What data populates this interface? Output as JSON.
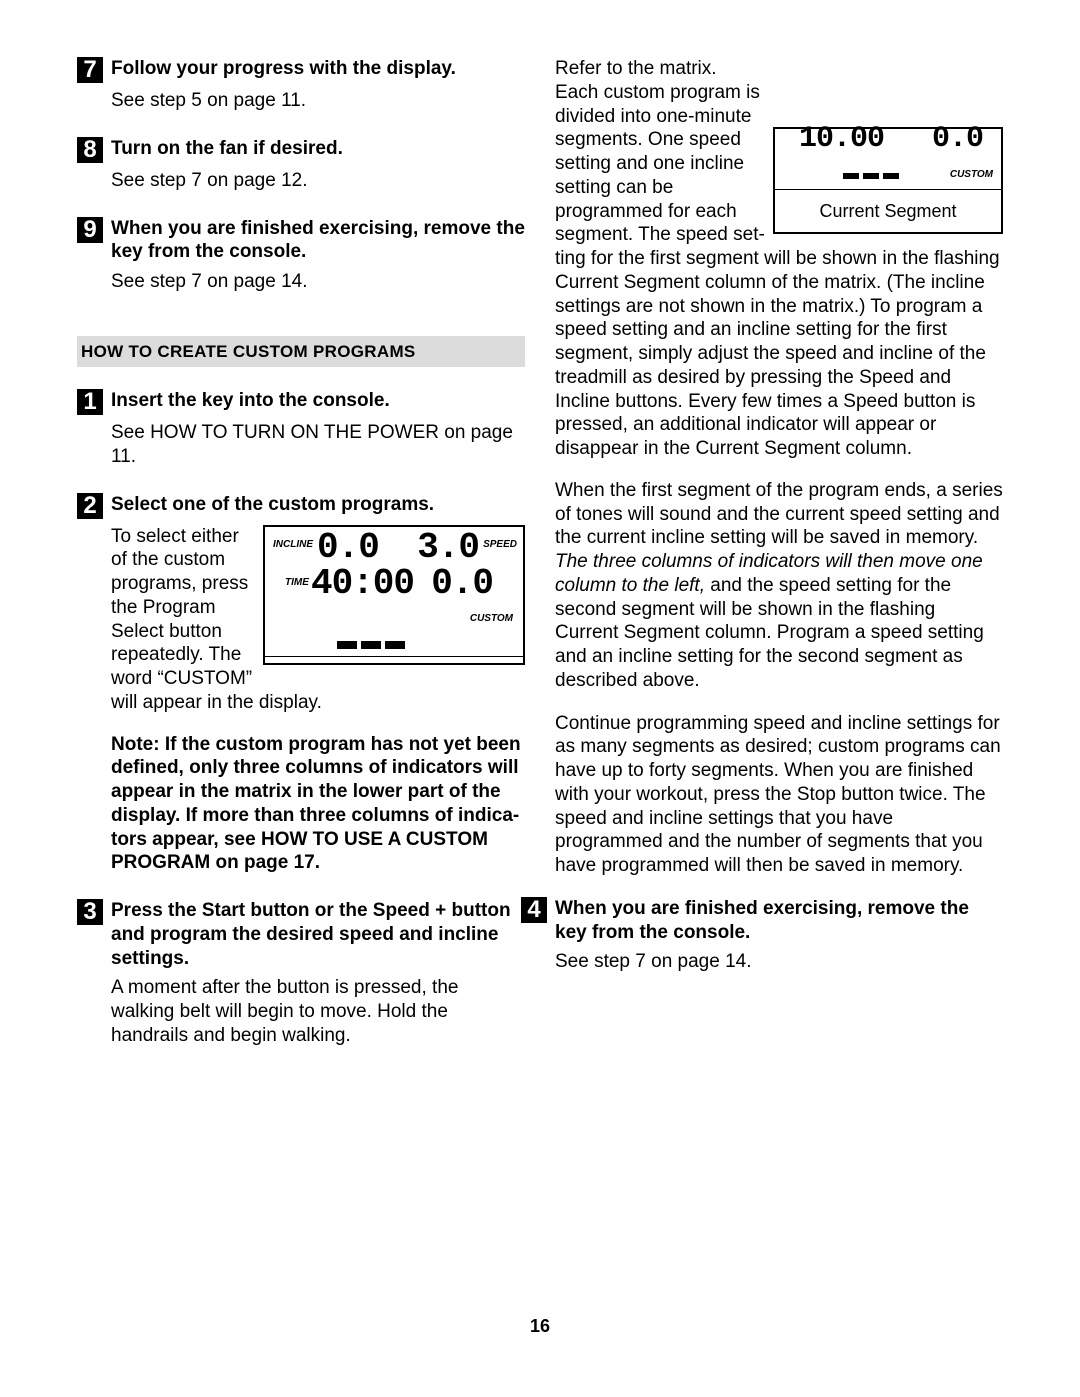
{
  "left": {
    "step7": {
      "num": "7",
      "title": "Follow your progress with the display.",
      "body": "See step 5 on page 11."
    },
    "step8": {
      "num": "8",
      "title": "Turn on the fan if desired.",
      "body": "See step 7 on page 12."
    },
    "step9": {
      "num": "9",
      "title": "When you are finished exercising, remove the key from the console.",
      "body": "See step 7 on page 14."
    },
    "sectionTitle": "HOW TO CREATE CUSTOM PROGRAMS",
    "c1": {
      "num": "1",
      "title": "Insert the key into the console.",
      "body": "See HOW TO TURN ON THE POWER on page 11."
    },
    "c2": {
      "num": "2",
      "title": "Select one of the custom programs.",
      "wrapText": "To select ei­ther of the custom pro­grams, press the Program Select but­ton repeat­edly. The word “CUSTOM” will appear in the display.",
      "note": "Note: If the custom program has not yet been defined, only three columns of indicators will appear in the matrix in the lower part of the display. If more than three columns of indica­tors appear, see HOW TO USE A CUSTOM PROGRAM on page 17.",
      "lcd": {
        "inclineLabel": "INCLINE",
        "incline": "0.0",
        "speedLabel": "SPEED",
        "speed": "3.0",
        "timeLabel": "TIME",
        "time": "40:00",
        "extra": "0.0",
        "custom": "CUSTOM"
      }
    },
    "c3": {
      "num": "3",
      "title": "Press the Start button or the Speed + button and program the desired speed and incline settings.",
      "body": "A moment after the button is pressed, the walking belt will begin to move. Hold the handrails and begin walking."
    }
  },
  "right": {
    "p1a": "Refer to the matrix. Each custom program is di­vided into one-minute segments. One speed set­ting and one incline setting can be programmed for each seg­ment. The speed set­ting for the first segment will be shown in the flashing Current Segment column of the matrix. (The in­cline settings are not shown in the matrix.) To pro­gram a speed setting and an incline setting for the first segment, simply adjust the speed and incline of the treadmill as desired by pressing the Speed and Incline buttons. Every few times a Speed but­ton is pressed, an additional indicator will appear or disappear in the Current Segment column.",
    "lcdSmall": {
      "big": "10.00",
      "small": "0.0",
      "custom": "CUSTOM",
      "caption": "Current Segment"
    },
    "p2a": "When the first segment of the program ends, a se­ries of tones will sound and the current speed set­ting and the current incline setting will be saved in memory. ",
    "p2i": "The three columns of indicators will then move one column to the left,",
    "p2b": " and the speed set­ting for the second segment will be shown in the flashing Current Segment column. Program a speed setting and an incline setting for the second segment as described above.",
    "p3": "Continue programming speed and incline settings for as many segments as desired; custom pro­grams can have up to forty segments. When you are finished with your workout, press the Stop but­ton twice. The speed and incline settings that you have programmed and the number of segments that you have programmed will then be saved in memory.",
    "c4": {
      "num": "4",
      "title": "When you are finished exercising, remove the key from the console.",
      "body": "See step 7 on page 14."
    }
  },
  "pageNumber": "16"
}
